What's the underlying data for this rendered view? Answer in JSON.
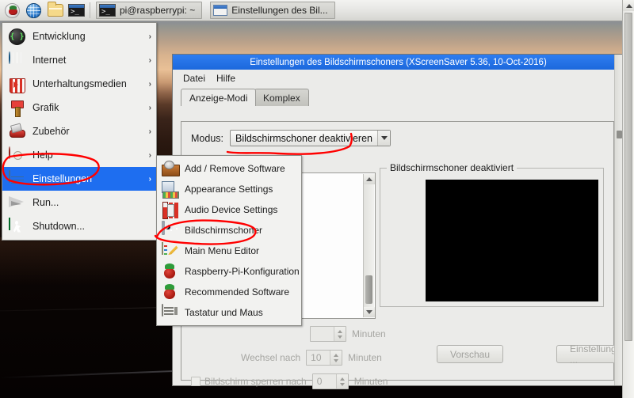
{
  "taskbar": {
    "launchers": [
      {
        "name": "raspberry-menu-icon",
        "label": ""
      },
      {
        "name": "web-browser-icon",
        "label": ""
      },
      {
        "name": "file-manager-icon",
        "label": ""
      },
      {
        "name": "terminal-icon",
        "label": ""
      }
    ],
    "windows": [
      {
        "label": "pi@raspberrypi: ~",
        "icon": "terminal-icon"
      },
      {
        "label": "Einstellungen des Bil...",
        "icon": "window-icon"
      }
    ]
  },
  "main_menu": {
    "items": [
      {
        "label": "Entwicklung",
        "icon": "development-icon",
        "has_submenu": true,
        "selected": false
      },
      {
        "label": "Internet",
        "icon": "internet-globe-icon",
        "has_submenu": true,
        "selected": false
      },
      {
        "label": "Unterhaltungsmedien",
        "icon": "media-icon",
        "has_submenu": true,
        "selected": false
      },
      {
        "label": "Grafik",
        "icon": "graphics-paintbrush-icon",
        "has_submenu": true,
        "selected": false
      },
      {
        "label": "Zubehör",
        "icon": "accessories-knife-icon",
        "has_submenu": true,
        "selected": false
      },
      {
        "label": "Help",
        "icon": "help-lifering-icon",
        "has_submenu": true,
        "selected": false
      },
      {
        "label": "Einstellungen",
        "icon": "settings-icon",
        "has_submenu": true,
        "selected": true
      },
      {
        "label": "Run...",
        "icon": "run-paperplane-icon",
        "has_submenu": false,
        "selected": false
      },
      {
        "label": "Shutdown...",
        "icon": "shutdown-exit-icon",
        "has_submenu": false,
        "selected": false
      }
    ],
    "arrow_glyph": "›",
    "highlight_color": "#1e6ef0"
  },
  "submenu": {
    "items": [
      {
        "label": "Add / Remove Software",
        "icon": "add-remove-software-icon"
      },
      {
        "label": "Appearance Settings",
        "icon": "appearance-settings-icon"
      },
      {
        "label": "Audio Device Settings",
        "icon": "audio-device-icon"
      },
      {
        "label": "Bildschirmschoner",
        "icon": "screensaver-icon"
      },
      {
        "label": "Main Menu Editor",
        "icon": "main-menu-editor-icon"
      },
      {
        "label": "Raspberry-Pi-Konfiguration",
        "icon": "raspberry-pi-icon"
      },
      {
        "label": "Recommended Software",
        "icon": "raspberry-pi-icon"
      },
      {
        "label": "Tastatur und Maus",
        "icon": "keyboard-mouse-icon"
      }
    ]
  },
  "dialog": {
    "title": "Einstellungen des Bildschirmschoners  (XScreenSaver 5.36, 10-Oct-2016)",
    "titlebar_color": "#1c68dd",
    "menubar": [
      "Datei",
      "Hilfe"
    ],
    "tabs": [
      {
        "label": "Anzeige-Modi",
        "active": true
      },
      {
        "label": "Komplex",
        "active": false
      }
    ],
    "modus_label": "Modus:",
    "modus_value": "Bildschirmschoner deaktivieren",
    "preview_group_label": "Bildschirmschoner deaktiviert",
    "timers": [
      {
        "label": "",
        "value": "",
        "unit": "Minuten",
        "has_checkbox": false
      },
      {
        "label": "Wechsel nach",
        "value": "10",
        "unit": "Minuten",
        "has_checkbox": false
      },
      {
        "label": "Bildschirm sperren nach",
        "value": "0",
        "unit": "Minuten",
        "has_checkbox": true
      }
    ],
    "buttons": [
      {
        "label": "Vorschau",
        "name": "preview-button"
      },
      {
        "label": "Einstellungen ...",
        "name": "settings-button"
      }
    ]
  },
  "annotations": {
    "color": "#ff0000",
    "marks": [
      "einstellungen-menu-circle",
      "bildschirmschoner-submenu-circle",
      "modus-combo-circle"
    ]
  }
}
